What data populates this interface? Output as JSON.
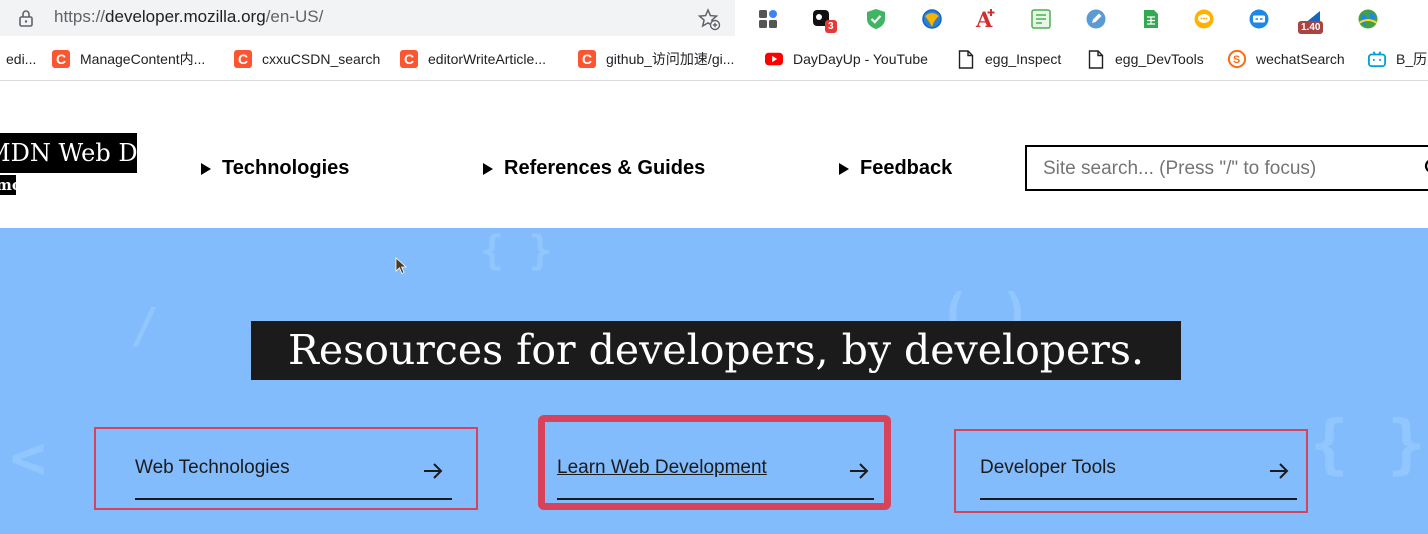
{
  "browser": {
    "url_prefix": "https://",
    "url_host": "developer.mozilla.org",
    "url_path": "/en-US/",
    "extensions": [
      {
        "name": "extensions-grid-icon"
      },
      {
        "name": "todo-extension-icon",
        "badge": "3",
        "badge_color": "#e53935"
      },
      {
        "name": "adguard-shield-icon"
      },
      {
        "name": "globe-extension-icon"
      },
      {
        "name": "font-extension-icon"
      },
      {
        "name": "reader-extension-icon"
      },
      {
        "name": "edit-pen-extension-icon"
      },
      {
        "name": "sheet-extension-icon"
      },
      {
        "name": "chat-bubble-extension-icon"
      },
      {
        "name": "caption-extension-icon"
      },
      {
        "name": "speed-extension-icon",
        "badge": "1.40",
        "badge_color": "#a94442"
      },
      {
        "name": "earth-extension-icon"
      }
    ]
  },
  "bookmarks": [
    {
      "label": "edi...",
      "icon": "c-icon"
    },
    {
      "label": "ManageContent内...",
      "icon": "c-icon"
    },
    {
      "label": "cxxuCSDN_search",
      "icon": "c-icon"
    },
    {
      "label": "editorWriteArticle...",
      "icon": "c-icon"
    },
    {
      "label": "github_访问加速/gi...",
      "icon": "c-icon"
    },
    {
      "label": "DayDayUp - YouTube",
      "icon": "youtube-icon"
    },
    {
      "label": "egg_Inspect",
      "icon": "page-icon"
    },
    {
      "label": "egg_DevTools",
      "icon": "page-icon"
    },
    {
      "label": "wechatSearch",
      "icon": "sogou-icon"
    },
    {
      "label": "B_历",
      "icon": "bilibili-icon"
    }
  ],
  "header": {
    "logo_text": "MDN Web Docs",
    "logo_sub": "moz://a",
    "nav": [
      {
        "label": "Technologies"
      },
      {
        "label": "References & Guides"
      },
      {
        "label": "Feedback"
      }
    ],
    "search_placeholder": "Site search... (Press \"/\" to focus)"
  },
  "hero": {
    "title": "Resources for developers, by developers.",
    "cards": [
      {
        "label": "Web Technologies"
      },
      {
        "label": "Learn Web Development"
      },
      {
        "label": "Developer Tools"
      }
    ]
  },
  "colors": {
    "hero_bg": "#83bcfc",
    "highlight": "#d6435b",
    "csdn": "#fc5531"
  }
}
